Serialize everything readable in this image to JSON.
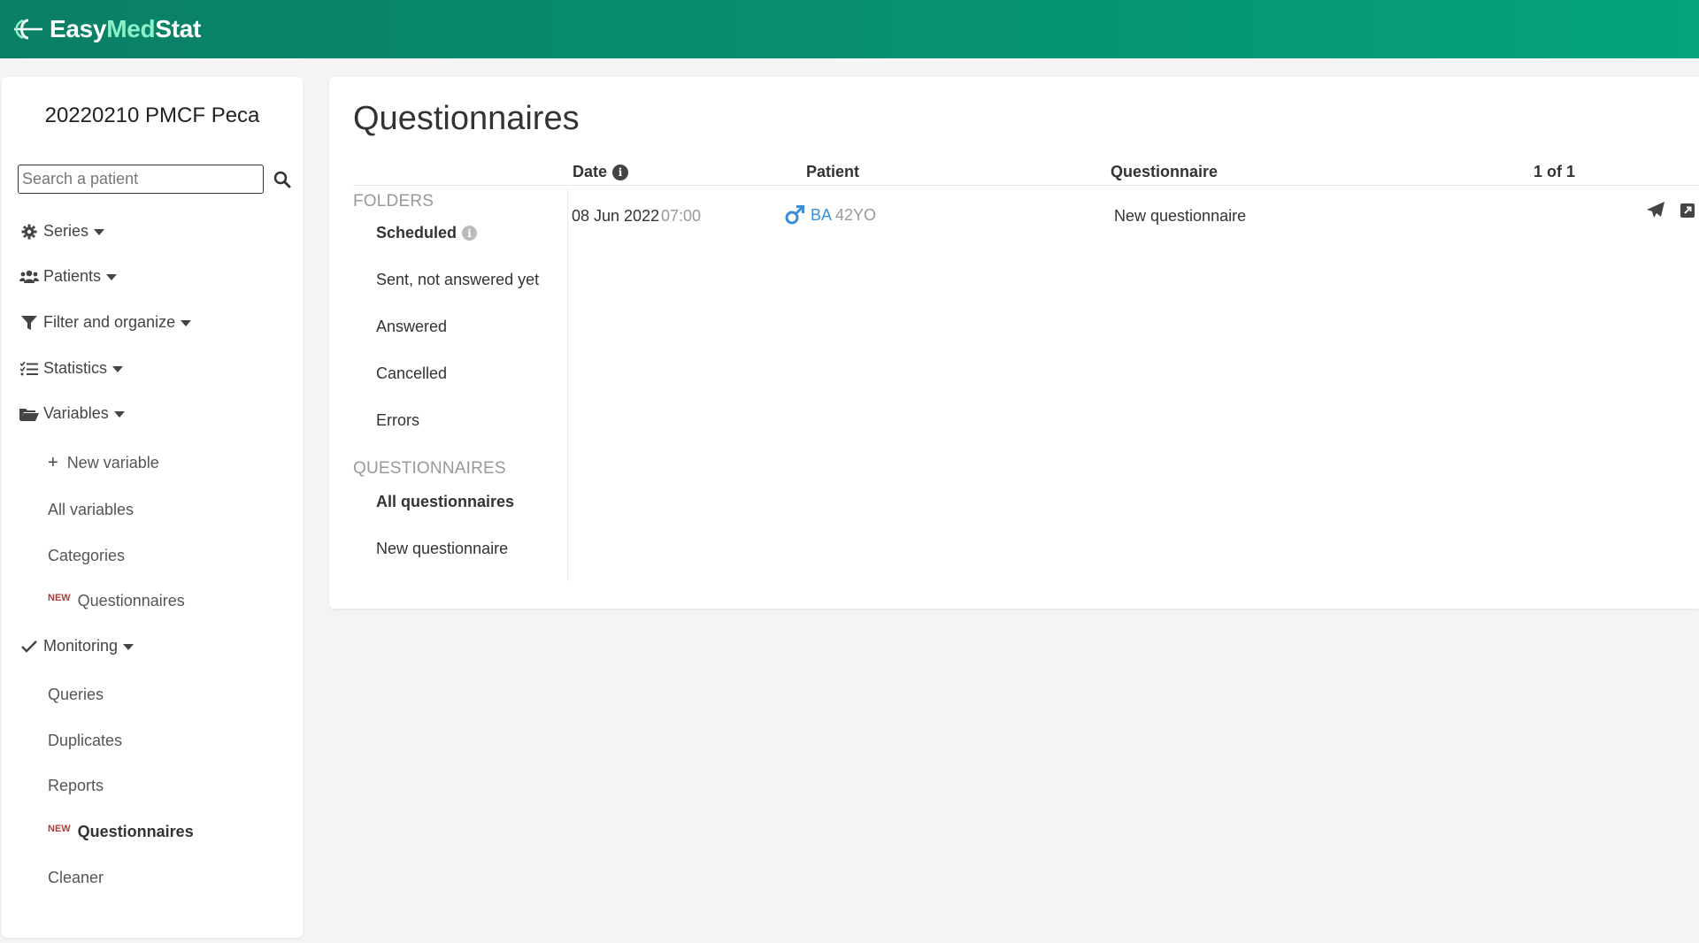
{
  "app": {
    "logo_easy": "Easy",
    "logo_med": "Med",
    "logo_stat": "Stat"
  },
  "sidebar": {
    "project_title": "20220210 PMCF Peca",
    "search": {
      "placeholder": "Search a patient",
      "value": ""
    },
    "menus": [
      {
        "label": "Series",
        "icon": "gear-icon"
      },
      {
        "label": "Patients",
        "icon": "users-icon"
      },
      {
        "label": "Filter and organize",
        "icon": "filter-icon"
      },
      {
        "label": "Statistics",
        "icon": "list-check-icon"
      },
      {
        "label": "Variables",
        "icon": "folder-open-icon"
      }
    ],
    "variables_items": [
      {
        "label": "New variable",
        "icon": "plus-icon"
      },
      {
        "label": "All variables"
      },
      {
        "label": "Categories"
      },
      {
        "label": "Questionnaires",
        "badge": "NEW"
      }
    ],
    "monitoring": {
      "label": "Monitoring",
      "icon": "check-icon"
    },
    "monitoring_items": [
      {
        "label": "Queries"
      },
      {
        "label": "Duplicates"
      },
      {
        "label": "Reports"
      },
      {
        "label": "Questionnaires",
        "badge": "NEW"
      },
      {
        "label": "Cleaner"
      }
    ]
  },
  "main": {
    "title": "Questionnaires",
    "columns": {
      "date": "Date",
      "patient": "Patient",
      "questionnaire": "Questionnaire",
      "pagination": "1 of 1"
    },
    "folders_label": "FOLDERS",
    "folders": [
      {
        "label": "Scheduled",
        "active": true
      },
      {
        "label": "Sent, not answered yet"
      },
      {
        "label": "Answered"
      },
      {
        "label": "Cancelled"
      },
      {
        "label": "Errors"
      }
    ],
    "questionnaires_label": "QUESTIONNAIRES",
    "questionnaires": [
      {
        "label": "All questionnaires",
        "active": true
      },
      {
        "label": "New questionnaire"
      }
    ],
    "rows": [
      {
        "date": "08 Jun 2022",
        "time": "07:00",
        "patient_code": "BA",
        "patient_age": "42YO",
        "questionnaire": "New questionnaire"
      }
    ]
  },
  "colors": {
    "brand_dark": "#0a7f66",
    "brand_light": "#05a37e",
    "link": "#3a8ed6",
    "badge": "#b33a3a"
  }
}
